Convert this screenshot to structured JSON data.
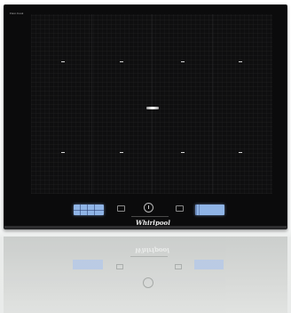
{
  "hob": {
    "series_mark": "Flexi·Cook",
    "brand": "Whirlpool",
    "cooking_zones": [
      {
        "name": "zone-1"
      },
      {
        "name": "zone-2"
      },
      {
        "name": "zone-3"
      },
      {
        "name": "zone-4"
      }
    ]
  },
  "colors": {
    "glass": "#0b0b0c",
    "display": "#8fb4e6",
    "logo": "#f1f1f1",
    "background": "#ffffff",
    "reflection": "#d6d8d6"
  },
  "icons": {
    "power": "power-icon",
    "left_key": "minus-key-icon",
    "right_key": "plus-key-icon"
  }
}
